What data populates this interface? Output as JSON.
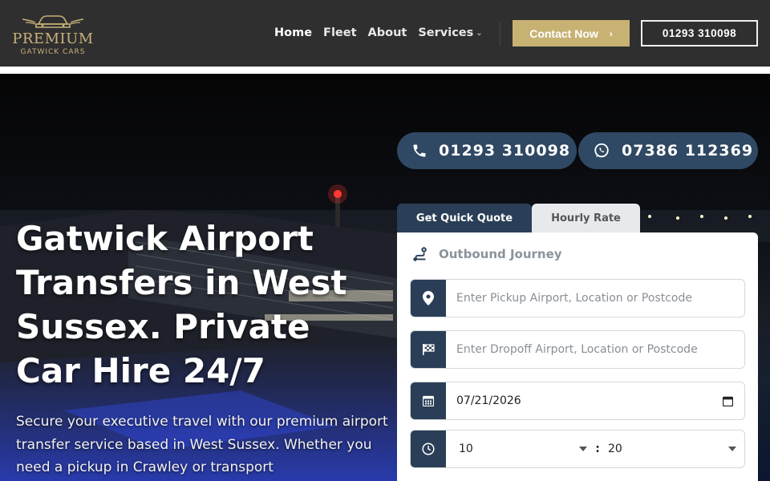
{
  "brand": {
    "logo_icon": "car-wings-icon",
    "name": "PREMIUM",
    "tagline": "GATWICK CARS",
    "accent": "#c8b273"
  },
  "nav": {
    "items": [
      {
        "label": "Home",
        "active": true
      },
      {
        "label": "Fleet",
        "active": false
      },
      {
        "label": "About",
        "active": false
      },
      {
        "label": "Services",
        "active": false,
        "has_dropdown": true
      }
    ],
    "dropdown_icon": "chevron-down-icon"
  },
  "header": {
    "contact_label": "Contact Now",
    "contact_icon": "chevron-right-icon",
    "phone_label": "01293 310098"
  },
  "hero": {
    "title": "Gatwick Airport Transfers in West Sussex. Private Car Hire 24/7",
    "description": "Secure your executive travel with our premium airport transfer service based in West Sussex. Whether you need a pickup in Crawley or transport",
    "phone_pill": {
      "icon": "phone-icon",
      "number": "01293 310098"
    },
    "whatsapp_pill": {
      "icon": "whatsapp-icon",
      "number": "07386 112369"
    }
  },
  "booking": {
    "tabs": [
      {
        "label": "Get Quick Quote",
        "active": true
      },
      {
        "label": "Hourly Rate",
        "active": false
      }
    ],
    "section_title": "Outbound Journey",
    "section_icon": "route-icon",
    "pickup": {
      "icon": "map-pin-icon",
      "placeholder": "Enter Pickup Airport, Location or Postcode",
      "value": ""
    },
    "dropoff": {
      "icon": "checkered-flag-icon",
      "placeholder": "Enter Dropoff Airport, Location or Postcode",
      "value": ""
    },
    "date": {
      "icon": "calendar-icon",
      "value": "07/21/2026"
    },
    "time": {
      "icon": "clock-icon",
      "hour": "10",
      "separator": ":",
      "minute": "20"
    }
  },
  "colors": {
    "header_bg": "#2f2f2f",
    "primary_navy": "#2a3f57",
    "pill_bg": "#2f4863",
    "gold": "#c8b273"
  }
}
